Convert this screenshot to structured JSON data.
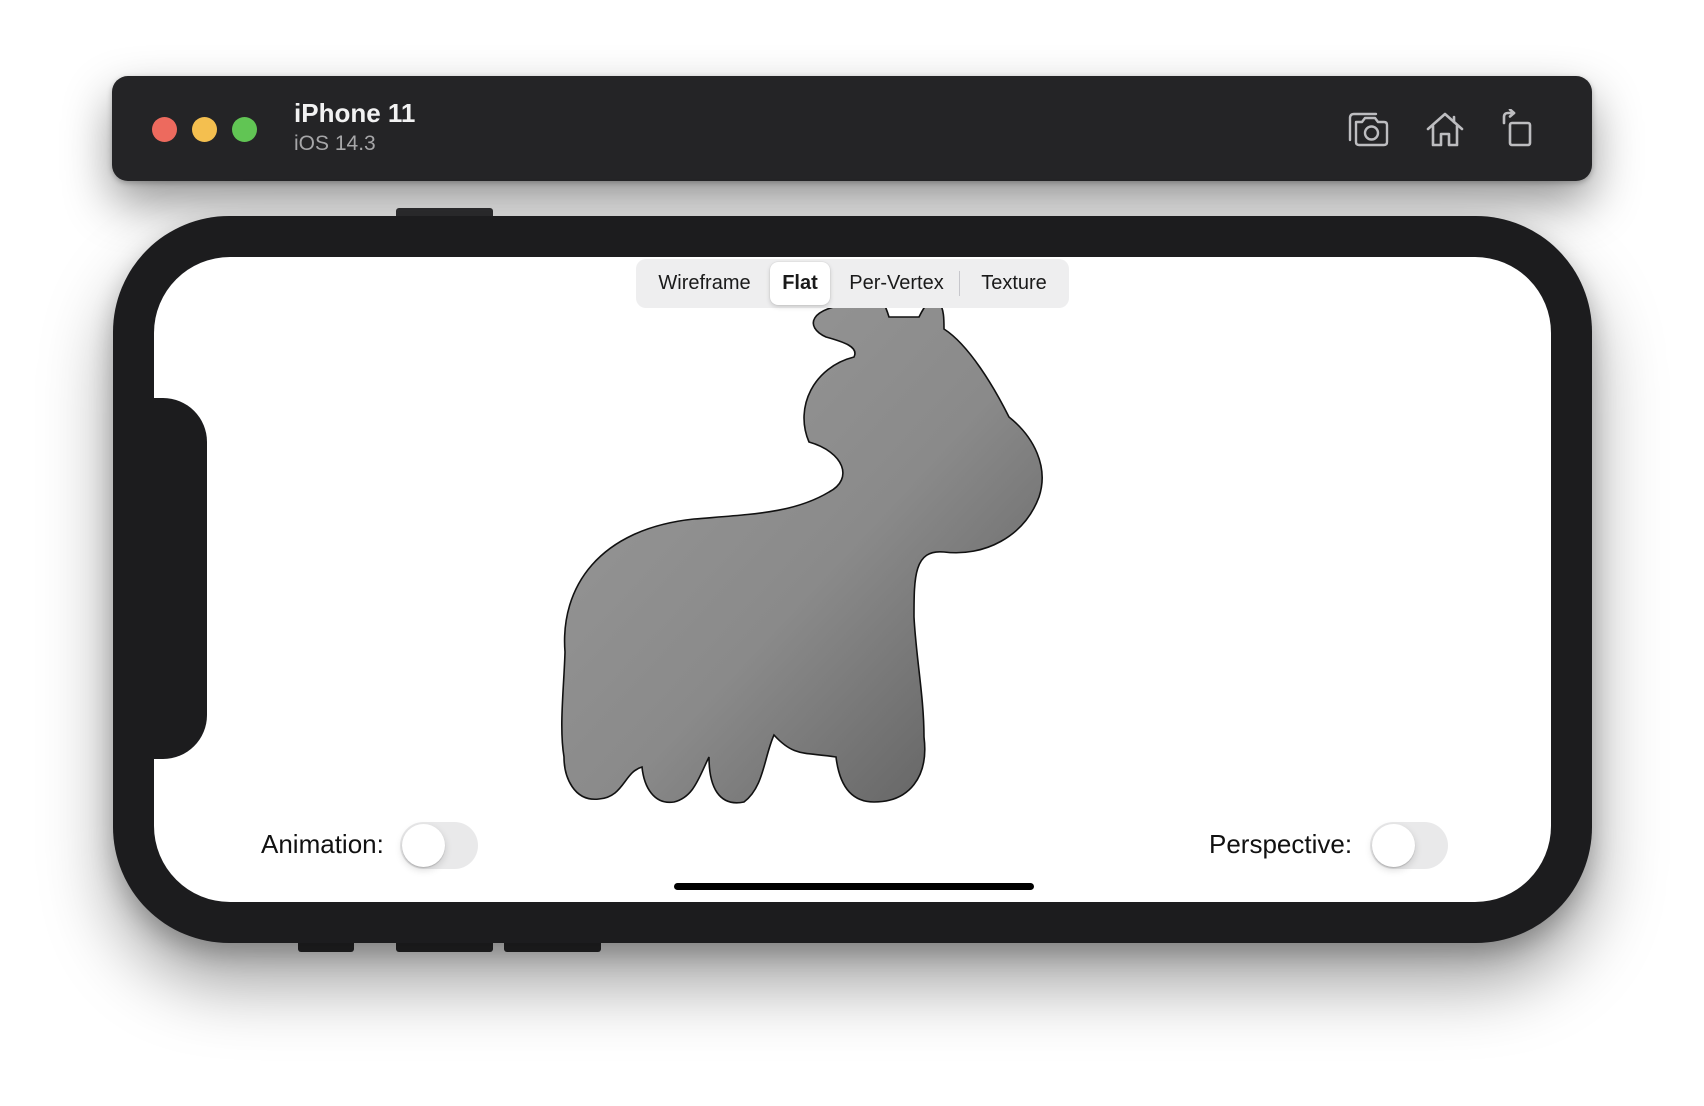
{
  "simulator": {
    "device_name": "iPhone 11",
    "os_version": "iOS 14.3",
    "toolbar": {
      "screenshot_icon": "camera-icon",
      "home_icon": "home-icon",
      "rotate_icon": "rotate-icon"
    },
    "colors": {
      "titlebar": "#242426",
      "close": "#ed6a5e",
      "minimize": "#f4bf4f",
      "zoom": "#61c554",
      "device_frame": "#1c1c1e"
    }
  },
  "app": {
    "render_modes": {
      "selected": "Flat",
      "items": [
        "Wireframe",
        "Flat",
        "Per-Vertex",
        "Texture"
      ]
    },
    "model": {
      "subject": "cow",
      "shading": "flat",
      "mesh_color": "#8a8a8a",
      "edge_color": "#1e1e1e"
    },
    "animation": {
      "label": "Animation:",
      "on": false
    },
    "perspective": {
      "label": "Perspective:",
      "on": false
    }
  }
}
